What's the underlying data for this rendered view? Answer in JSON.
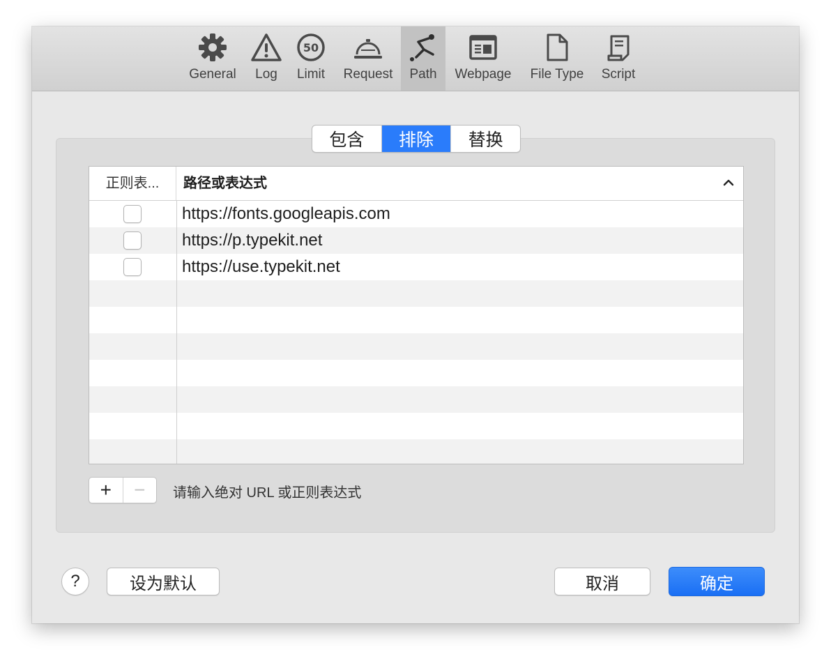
{
  "toolbar": {
    "items": [
      {
        "label": "General",
        "icon": "gear-icon"
      },
      {
        "label": "Log",
        "icon": "warning-icon"
      },
      {
        "label": "Limit",
        "icon": "speed-limit-icon",
        "badge": "50"
      },
      {
        "label": "Request",
        "icon": "service-bell-icon"
      },
      {
        "label": "Path",
        "icon": "path-icon",
        "selected": true
      },
      {
        "label": "Webpage",
        "icon": "webpage-icon"
      },
      {
        "label": "File Type",
        "icon": "file-icon"
      },
      {
        "label": "Script",
        "icon": "script-icon"
      }
    ]
  },
  "segments": [
    "包含",
    "排除",
    "替换"
  ],
  "segments_active": "排除",
  "table": {
    "headers": [
      "正则表...",
      "路径或表达式"
    ],
    "rows": [
      {
        "regex": false,
        "path": "https://fonts.googleapis.com"
      },
      {
        "regex": false,
        "path": "https://p.typekit.net"
      },
      {
        "regex": false,
        "path": "https://use.typekit.net"
      }
    ]
  },
  "controls": {
    "add": "+",
    "remove": "−",
    "hint": "请输入绝对 URL 或正则表达式"
  },
  "footer": {
    "help": "?",
    "default_button": "设为默认",
    "cancel_button": "取消",
    "ok_button": "确定"
  },
  "colors": {
    "accent": "#2a7cfb"
  }
}
